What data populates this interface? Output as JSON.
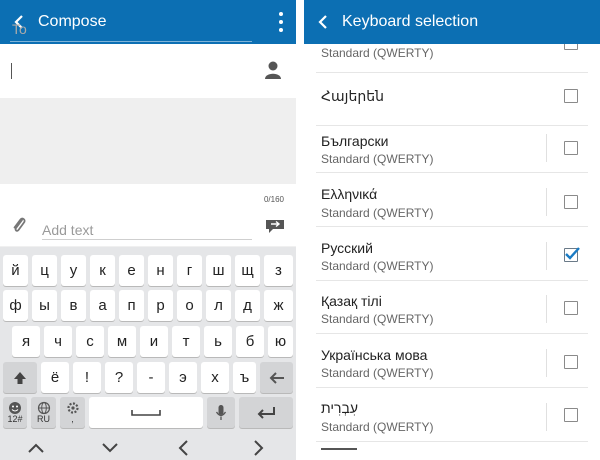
{
  "compose": {
    "title": "Compose",
    "to_placeholder": "To",
    "char_count": "0/160",
    "add_text_placeholder": "Add text"
  },
  "keyboard": {
    "row1": [
      "й",
      "ц",
      "у",
      "к",
      "е",
      "н",
      "г",
      "ш",
      "щ",
      "з"
    ],
    "row2": [
      "ф",
      "ы",
      "в",
      "а",
      "п",
      "р",
      "о",
      "л",
      "д",
      "ж"
    ],
    "row3": [
      "я",
      "ч",
      "с",
      "м",
      "и",
      "т",
      "ь",
      "б",
      "ю"
    ],
    "row4": [
      "ё",
      "!",
      "?",
      "-",
      "э",
      "х",
      "ъ"
    ],
    "emoji_sub": "12#",
    "lang_sub": "RU",
    "settings_sub": ","
  },
  "keyboard_selection": {
    "title": "Keyboard selection",
    "items": [
      {
        "name": "",
        "layout": "Standard (QWERTY)",
        "checked": false
      },
      {
        "name": "Հայերեն",
        "layout": "",
        "checked": false
      },
      {
        "name": "Български",
        "layout": "Standard (QWERTY)",
        "checked": false
      },
      {
        "name": "Ελληνικά",
        "layout": "Standard (QWERTY)",
        "checked": false
      },
      {
        "name": "Русский",
        "layout": "Standard (QWERTY)",
        "checked": true
      },
      {
        "name": "Қазақ тілі",
        "layout": "Standard (QWERTY)",
        "checked": false
      },
      {
        "name": "Українська мова",
        "layout": "Standard (QWERTY)",
        "checked": false
      },
      {
        "name": "עִבְרִית",
        "layout": "Standard (QWERTY)",
        "checked": false
      }
    ]
  },
  "colors": {
    "appbar": "#0c6fb3",
    "check_accent": "#1a7bc4"
  }
}
